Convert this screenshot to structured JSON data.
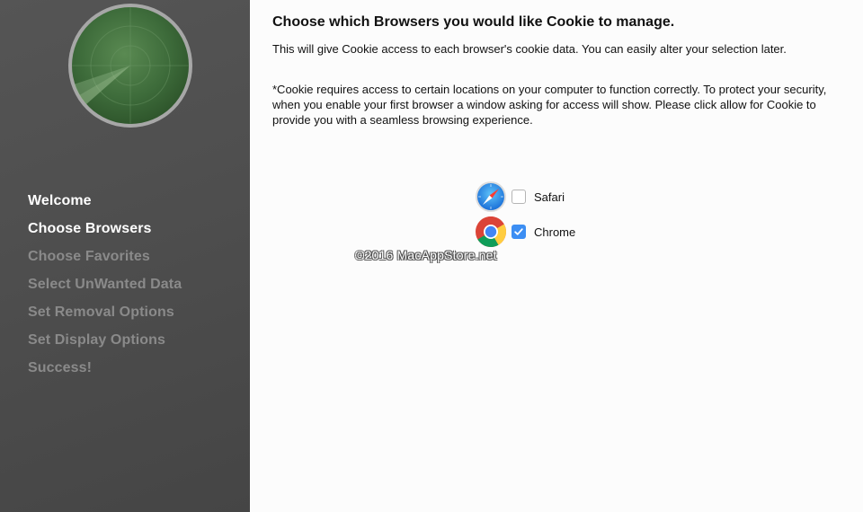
{
  "sidebar": {
    "logo_icon": "radar-logo-icon",
    "items": [
      {
        "label": "Welcome",
        "state": "done"
      },
      {
        "label": "Choose Browsers",
        "state": "active"
      },
      {
        "label": "Choose Favorites",
        "state": "pending"
      },
      {
        "label": "Select UnWanted Data",
        "state": "pending"
      },
      {
        "label": "Set Removal Options",
        "state": "pending"
      },
      {
        "label": "Set Display Options",
        "state": "pending"
      },
      {
        "label": "Success!",
        "state": "pending"
      }
    ]
  },
  "main": {
    "title": "Choose which Browsers you would like Cookie to manage.",
    "description": "This will give Cookie access to each browser's cookie data. You can easily alter your selection later.",
    "note": "*Cookie requires access to certain locations on your computer to function correctly. To protect your security, when you enable your first browser a window asking for access will show. Please click allow for Cookie to provide you with a seamless browsing experience.",
    "browsers": [
      {
        "name": "Safari",
        "icon": "safari-icon",
        "checked": false
      },
      {
        "name": "Chrome",
        "icon": "chrome-icon",
        "checked": true
      }
    ],
    "watermark": "©2016 MacAppStore.net"
  },
  "colors": {
    "sidebar_bg": "#4f4f4f",
    "sidebar_active": "#ffffff",
    "sidebar_inactive": "#8a8a8a",
    "checkbox_accent": "#3c8ef3",
    "logo_green": "#3d6b3a"
  }
}
